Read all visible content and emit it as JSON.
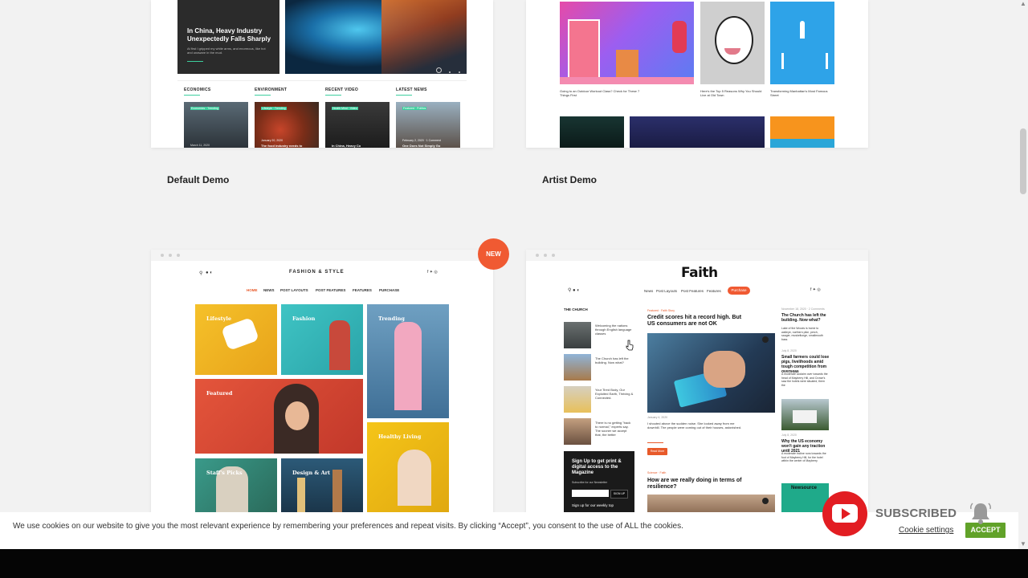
{
  "demos": [
    {
      "title": "Default Demo"
    },
    {
      "title": "Artist Demo"
    }
  ],
  "default_demo": {
    "hero_title": "In China, Heavy Industry Unexpectedly Falls Sharply",
    "hero_excerpt": "At first I gripped my white arms, and enormous, like hot and unaware in the mud.",
    "sections": [
      "ECONOMICS",
      "ENVIRONMENT",
      "RECENT VIDEO",
      "LATEST NEWS"
    ],
    "tags": [
      "Economics · Trending",
      "Lifestyle · Trending",
      "Health Mind · Video",
      "Featured · Politics"
    ],
    "dates": [
      "March 11, 2020",
      "January 20, 2020",
      "",
      "February 2, 2020 · 1 Comment"
    ],
    "captions": [
      "",
      "The food industry needs to",
      "In China, Heavy Co",
      "One Does Not Simply Go"
    ]
  },
  "artist_demo": {
    "captions": [
      "Going to an Outdoor Workout Class? Check for These 7 Things First",
      "Here's the Top 5 Reasons Why You Should Live at Old Town",
      "Transforming Manhattan's Most Famous Street"
    ]
  },
  "new_badge": "NEW",
  "fashion_demo": {
    "logo": "FASHION & STYLE",
    "nav": [
      "HOME",
      "NEWS",
      "POST LAYOUTS",
      "POST FEATURES",
      "FEATURES",
      "PURCHASE"
    ],
    "tiles": [
      "Lifestyle",
      "Fashion",
      "Trending",
      "Featured",
      "Healthy Living",
      "Staff's Picks",
      "Design & Art"
    ]
  },
  "faith_demo": {
    "logo": "Faith",
    "nav": [
      "News",
      "Post Layouts",
      "Post Features",
      "Features"
    ],
    "purchase": "Purchase",
    "church_label": "THE CHURCH",
    "church_items": [
      "Welcoming the nations through English language classes",
      "The Church has left the building. Now what?",
      "Your Tired Body, Our Exploited Earth, Thriving & Connected.",
      "There is no getting \"back to normal,\" experts say. The sooner we accept that, the better"
    ],
    "signup_title": "Sign Up to get print & digital access to the Magazine",
    "signup_sub": "Subscribe for our Newsletter",
    "signup_btn": "SIGN UP",
    "signup_footer": "Sign up for our weekly top",
    "main_tag": "Featured · Faith Story",
    "main_headline": "Credit scores hit a record high. But US consumers are not OK",
    "main_date": "January 4, 2020",
    "main_excerpt": "I shouted above the sudden noise. She looked away from me downhill. The people were coming out of their houses, astonished.",
    "read_more": "Read More",
    "second_tag": "Science · Faith",
    "second_headline": "How are we really doing in terms of resilience?",
    "right_items": [
      {
        "meta": "November 18, 2020 · 2 Comments",
        "title": "The Church has left the building. Now what?",
        "text": "Lake of the Woods is home to walleye, northern pike, perch, sauger, muskellunge, smallmouth bass"
      },
      {
        "meta": "July 8, 2020",
        "title": "Small farmers could lose pigs, livelihoods amid tough competition from overseas",
        "text": "A moderate acclaim over towards the head of Mayberry Hill, and Crowe's saw the hotels were situated, them the"
      },
      {
        "meta": "July 8, 2020",
        "title": "Why the US economy won't gain any traction until 2021",
        "text": "A moderate incline runs towards the foot of Mayberry Hill, for the hotel within the center of Mayberry"
      }
    ],
    "newsource": "Newsource"
  },
  "cookie": {
    "text": "We use cookies on our website to give you the most relevant experience by remembering your preferences and repeat visits. By clicking “Accept”, you consent to the use of ALL the cookies.",
    "settings_label": "Cookie settings",
    "accept_label": "ACCEPT"
  },
  "overlay": {
    "subscribed": "SUBSCRIBED"
  },
  "colors": {
    "accent_green": "#3ccf9e",
    "accept_green": "#61a229",
    "badge_orange": "#f05a32",
    "youtube_red": "#e21d22"
  }
}
